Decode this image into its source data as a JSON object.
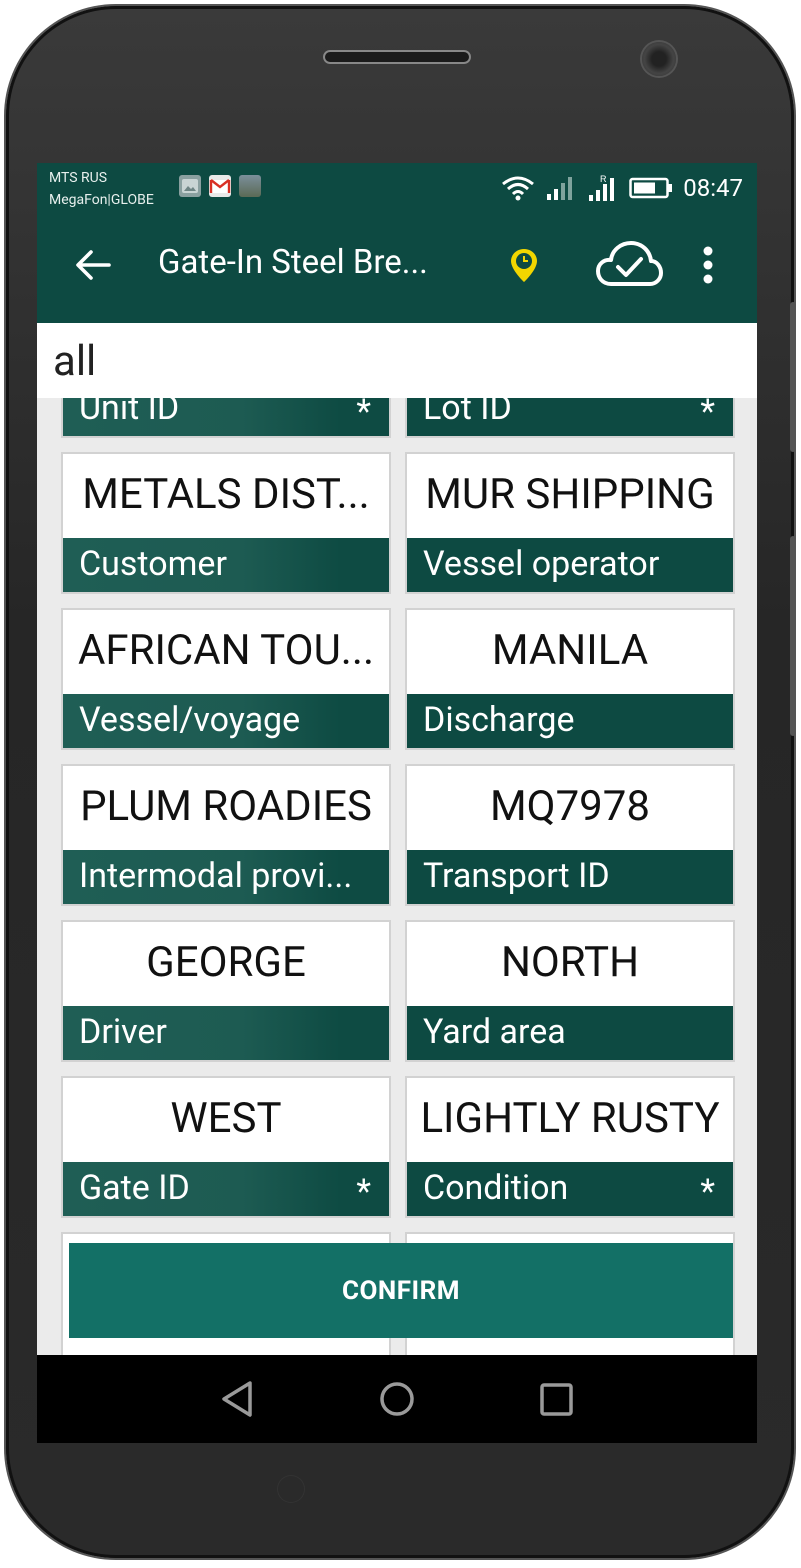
{
  "statusbar": {
    "carrier1": "MTS RUS",
    "carrier2": "MegaFon|GLOBE",
    "time": "08:47",
    "notification_icons": [
      "image-icon",
      "gmail-icon",
      "photo-icon"
    ]
  },
  "appbar": {
    "title": "Gate-In Steel Bre...",
    "accent_pin_color": "#f2d600"
  },
  "search": {
    "value": "all"
  },
  "tiles": [
    {
      "value": "",
      "label": "Unit ID",
      "required": "*"
    },
    {
      "value": "",
      "label": "Lot ID",
      "required": "*"
    },
    {
      "value": "METALS DIST...",
      "label": "Customer",
      "required": ""
    },
    {
      "value": "MUR SHIPPING",
      "label": "Vessel operator",
      "required": ""
    },
    {
      "value": "AFRICAN TOU...",
      "label": "Vessel/voyage",
      "required": ""
    },
    {
      "value": "MANILA",
      "label": "Discharge",
      "required": ""
    },
    {
      "value": "PLUM ROADIES",
      "label": "Intermodal provi...",
      "required": ""
    },
    {
      "value": "MQ7978",
      "label": "Transport ID",
      "required": ""
    },
    {
      "value": "GEORGE",
      "label": "Driver",
      "required": ""
    },
    {
      "value": "NORTH",
      "label": "Yard area",
      "required": ""
    },
    {
      "value": "WEST",
      "label": "Gate ID",
      "required": "*"
    },
    {
      "value": "LIGHTLY RUSTY",
      "label": "Condition",
      "required": "*"
    }
  ],
  "confirm_label": "CONFIRM",
  "colors": {
    "primary": "#0d4a42",
    "button": "#137066"
  }
}
